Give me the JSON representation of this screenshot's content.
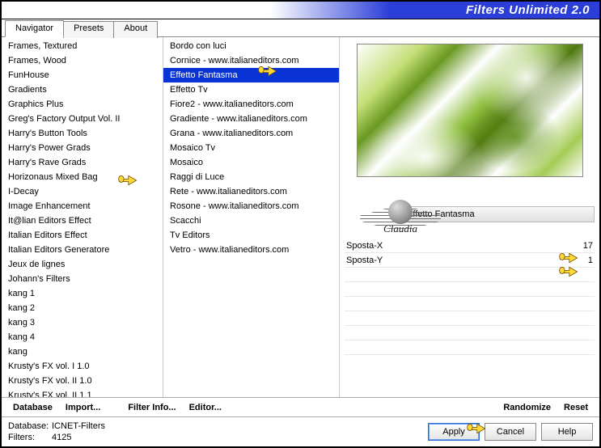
{
  "title": "Filters Unlimited 2.0",
  "tabs": [
    "Navigator",
    "Presets",
    "About"
  ],
  "leftList": [
    "Frames, Textured",
    "Frames, Wood",
    "FunHouse",
    "Gradients",
    "Graphics Plus",
    "Greg's Factory Output Vol. II",
    "Harry's Button Tools",
    "Harry's Power Grads",
    "Harry's Rave Grads",
    "Horizonaus Mixed Bag",
    "I-Decay",
    "Image Enhancement",
    "It@lian Editors Effect",
    "Italian Editors Effect",
    "Italian Editors Generatore",
    "Jeux de lignes",
    "Johann's Filters",
    "kang 1",
    "kang 2",
    "kang 3",
    "kang 4",
    "kang",
    "Krusty's FX vol. I 1.0",
    "Krusty's FX vol. II 1.0",
    "Krusty's FX vol. II 1.1"
  ],
  "middleList": [
    {
      "t": "Bordo con luci",
      "sel": false
    },
    {
      "t": "Cornice - www.italianeditors.com",
      "sel": false
    },
    {
      "t": "Effetto Fantasma",
      "sel": true
    },
    {
      "t": "Effetto Tv",
      "sel": false
    },
    {
      "t": "Fiore2 - www.italianeditors.com",
      "sel": false
    },
    {
      "t": "Gradiente - www.italianeditors.com",
      "sel": false
    },
    {
      "t": "Grana - www.italianeditors.com",
      "sel": false
    },
    {
      "t": "Mosaico Tv",
      "sel": false
    },
    {
      "t": "Mosaico",
      "sel": false
    },
    {
      "t": "Raggi di Luce",
      "sel": false
    },
    {
      "t": "Rete - www.italianeditors.com",
      "sel": false
    },
    {
      "t": "Rosone - www.italianeditors.com",
      "sel": false
    },
    {
      "t": "Scacchi",
      "sel": false
    },
    {
      "t": "Tv Editors",
      "sel": false
    },
    {
      "t": "Vetro - www.italianeditors.com",
      "sel": false
    }
  ],
  "filterName": "Effetto Fantasma",
  "params": [
    {
      "label": "Sposta-X",
      "value": "17"
    },
    {
      "label": "Sposta-Y",
      "value": "1"
    }
  ],
  "actions": {
    "database": "Database",
    "import": "Import...",
    "filterInfo": "Filter Info...",
    "editor": "Editor...",
    "randomize": "Randomize",
    "reset": "Reset"
  },
  "footer": {
    "dbLabel": "Database:",
    "dbValue": "ICNET-Filters",
    "filtersLabel": "Filters:",
    "filtersValue": "4125"
  },
  "buttons": {
    "apply": "Apply",
    "cancel": "Cancel",
    "help": "Help"
  },
  "watermark": "Claudia"
}
